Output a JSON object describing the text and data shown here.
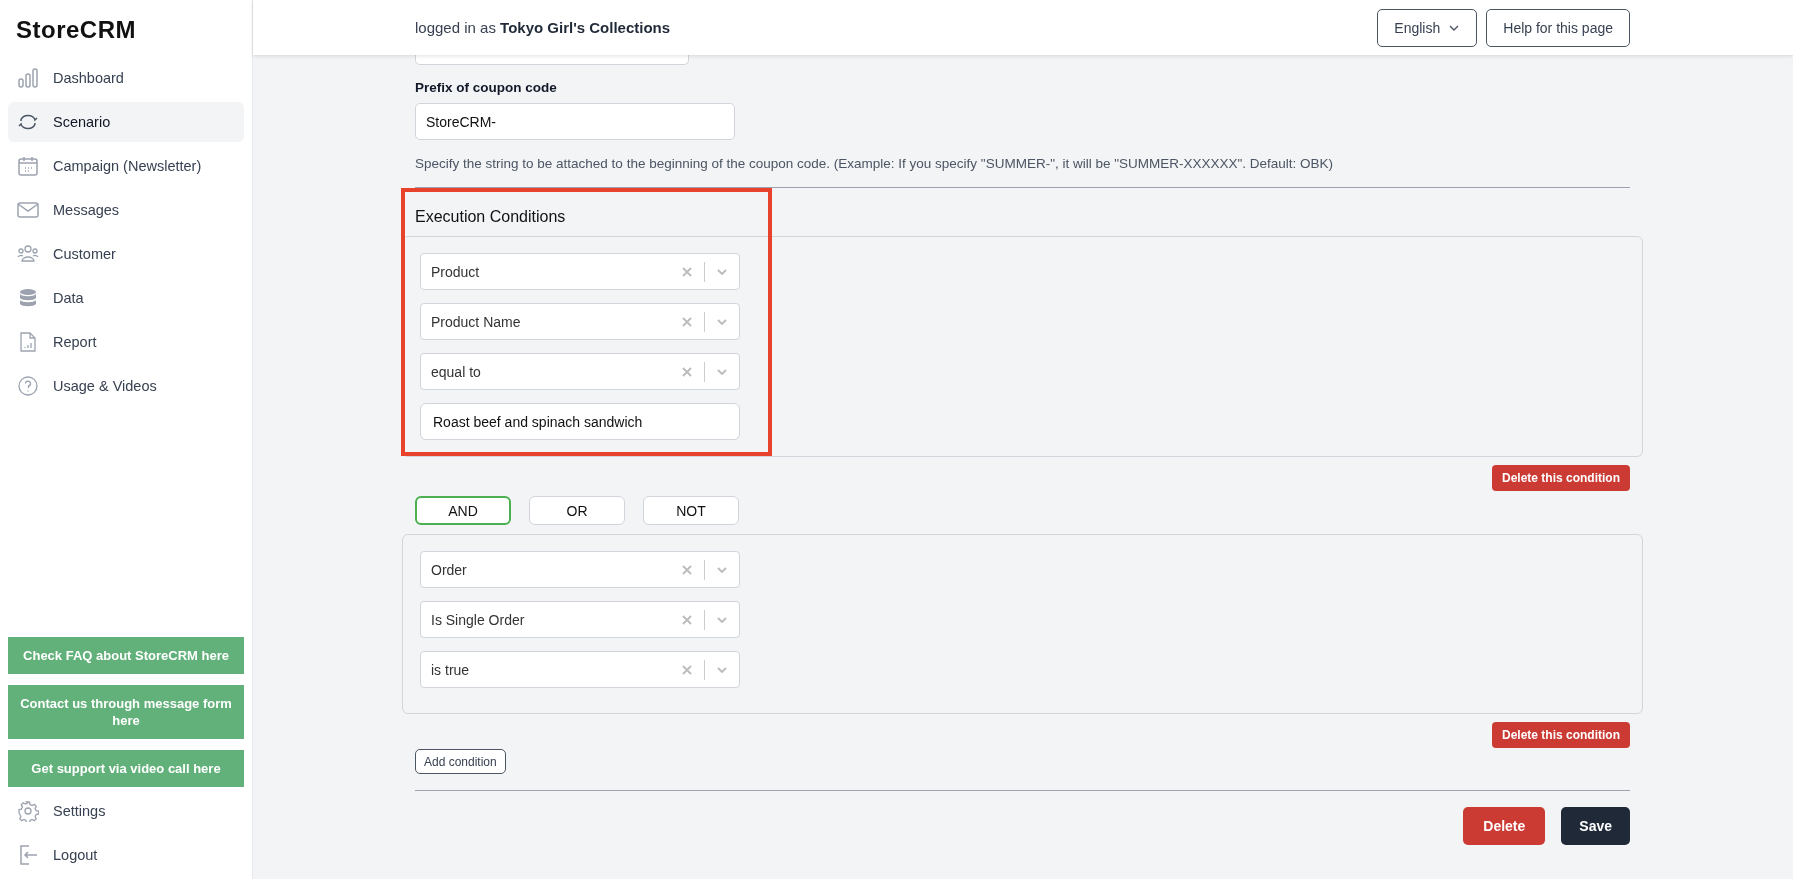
{
  "sidebar": {
    "logo": "StoreCRM",
    "items": [
      {
        "label": "Dashboard",
        "selected": false
      },
      {
        "label": "Scenario",
        "selected": true
      },
      {
        "label": "Campaign (Newsletter)",
        "selected": false
      },
      {
        "label": "Messages",
        "selected": false
      },
      {
        "label": "Customer",
        "selected": false
      },
      {
        "label": "Data",
        "selected": false
      },
      {
        "label": "Report",
        "selected": false
      },
      {
        "label": "Usage & Videos",
        "selected": false
      }
    ],
    "support_links": [
      "Check FAQ about StoreCRM here",
      "Contact us through message form here",
      "Get support via video call here"
    ],
    "bottom_items": [
      "Settings",
      "Logout"
    ]
  },
  "header": {
    "login_prefix": "logged in as",
    "account": "Tokyo Girl's Collections",
    "language": "English",
    "help": "Help for this page"
  },
  "form": {
    "prefix_label": "Prefix of coupon code",
    "prefix_value": "StoreCRM-",
    "prefix_hint": "Specify the string to be attached to the beginning of the coupon code. (Example: If you specify \"SUMMER-\", it will be \"SUMMER-XXXXXX\". Default: OBK)",
    "conditions_title": "Execution Conditions",
    "condition_groups": [
      {
        "fields": [
          {
            "kind": "select",
            "value": "Product"
          },
          {
            "kind": "select",
            "value": "Product Name"
          },
          {
            "kind": "select",
            "value": "equal to"
          },
          {
            "kind": "text",
            "value": "Roast beef and spinach sandwich"
          }
        ],
        "delete": "Delete this condition",
        "highlighted": true
      },
      {
        "operators": [
          {
            "label": "AND",
            "selected": true
          },
          {
            "label": "OR",
            "selected": false
          },
          {
            "label": "NOT",
            "selected": false
          }
        ],
        "fields": [
          {
            "kind": "select",
            "value": "Order"
          },
          {
            "kind": "select",
            "value": "Is Single Order"
          },
          {
            "kind": "select",
            "value": "is true"
          }
        ],
        "delete": "Delete this condition"
      }
    ],
    "add_condition": "Add condition",
    "delete": "Delete",
    "save": "Save"
  }
}
